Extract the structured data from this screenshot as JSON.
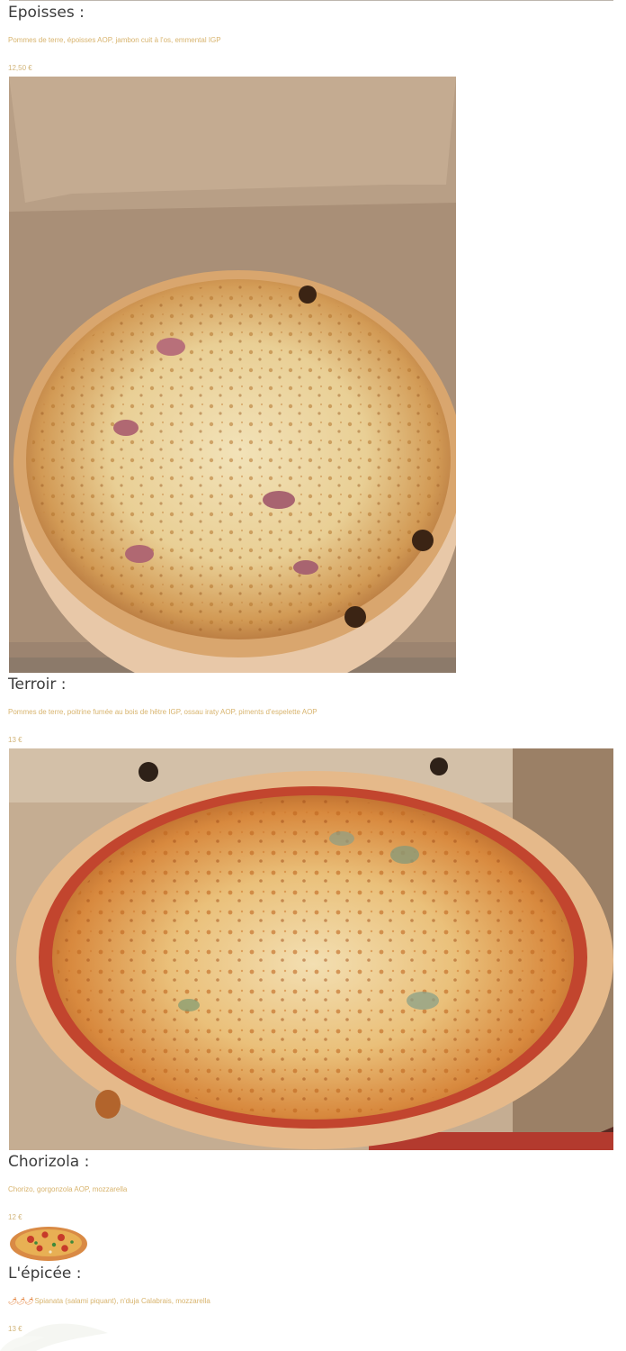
{
  "menu": {
    "items": [
      {
        "name": "Epoisses :",
        "description": "Pommes de terre, époisses AOP, jambon cuit à l'os, emmental IGP",
        "price": "12,50 €",
        "image": "pizza-epoisses-photo"
      },
      {
        "name": "Terroir :",
        "description": "Pommes de terre, poitrine fumée au bois de hêtre IGP, ossau iraty AOP, piments d'espelette AOP",
        "price": "13 €",
        "image": "pizza-terroir-photo"
      },
      {
        "name": "Chorizola :",
        "description": "Chorizo, gorgonzola AOP, mozzarella",
        "price": "12 €",
        "image": "pizza-thumbnail-icon"
      },
      {
        "name": "L'épicée :",
        "description": "Spianata (salami piquant), n'duja Calabrais, mozzarella",
        "spice_icons": "🌶🌶🌶",
        "price": "13 €"
      }
    ]
  },
  "colors": {
    "title": "#3c3c3c",
    "description": "#d8b46e",
    "price": "#d2b57a"
  }
}
